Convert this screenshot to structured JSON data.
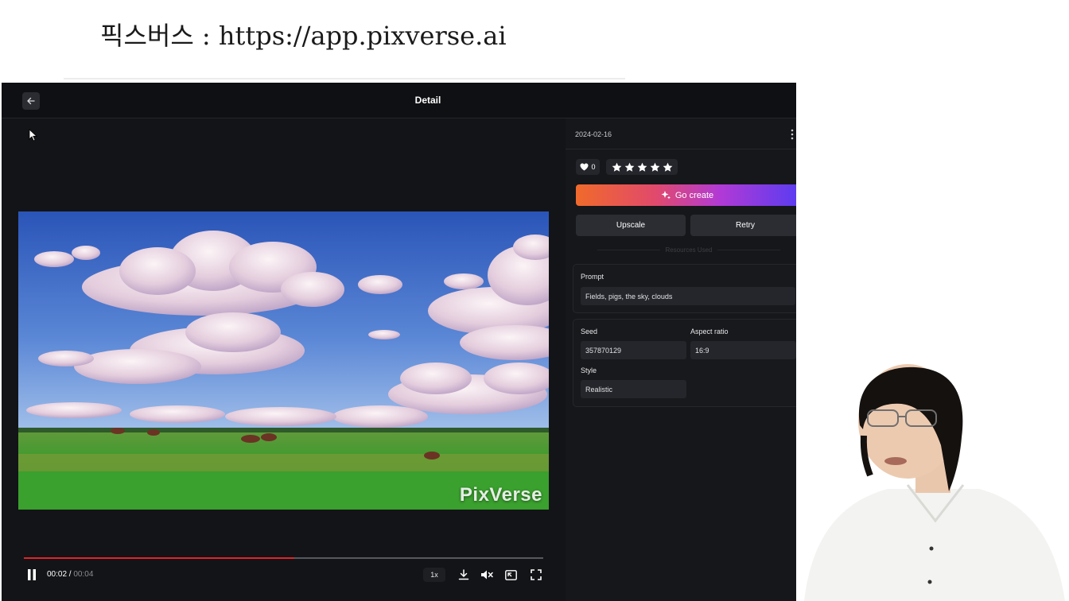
{
  "caption": {
    "text": "픽스버스 : https://app.pixverse.ai"
  },
  "topbar": {
    "title": "Detail"
  },
  "video": {
    "watermark": "PixVerse"
  },
  "player": {
    "current_time": "00:02",
    "separator": " / ",
    "duration": "00:04",
    "progress_fraction": 0.52,
    "speed": "1x"
  },
  "panel": {
    "date": "2024-02-16",
    "likes": "0",
    "stars_total": 5,
    "go_create_label": "Go create",
    "upscale_label": "Upscale",
    "retry_label": "Retry",
    "resources_label": "Resources Used",
    "prompt_label": "Prompt",
    "prompt_value": "Fields, pigs, the sky, clouds",
    "seed_label": "Seed",
    "seed_value": "357870129",
    "aspect_label": "Aspect ratio",
    "aspect_value": "16:9",
    "style_label": "Style",
    "style_value": "Realistic"
  },
  "colors": {
    "app_bg": "#131417",
    "panel_bg": "#16171a",
    "progress": "#e0242a",
    "gradient_start": "#f06a2b",
    "gradient_end": "#5a3cf0"
  }
}
